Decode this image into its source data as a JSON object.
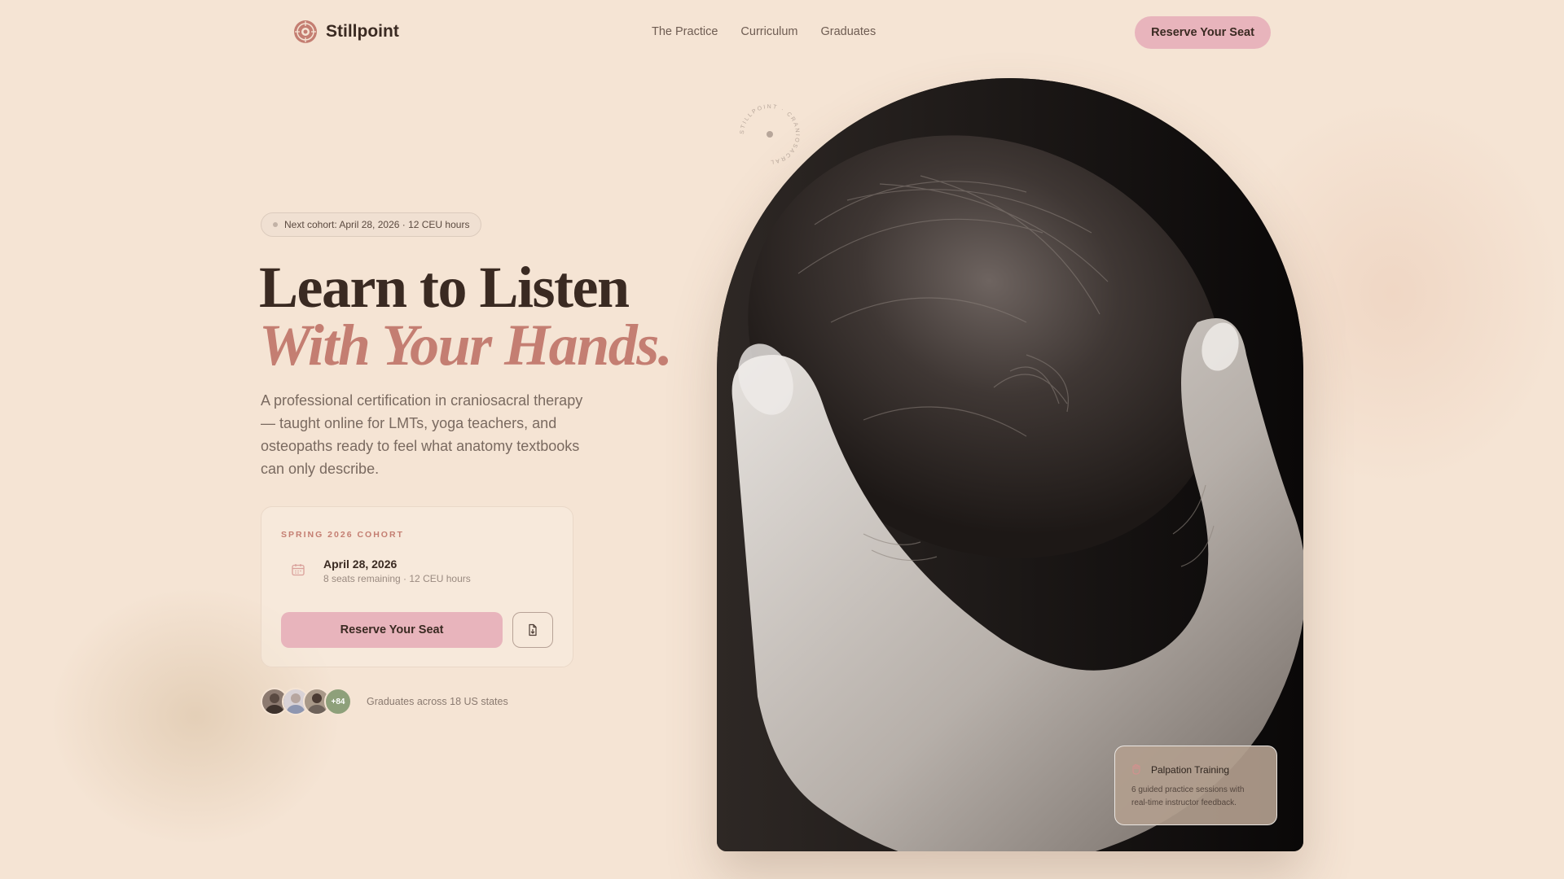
{
  "brand": {
    "name": "Stillpoint"
  },
  "nav": {
    "links": [
      "The Practice",
      "Curriculum",
      "Graduates"
    ],
    "cta_label": "Reserve Your Seat"
  },
  "hero": {
    "badge": "Next cohort: April 28, 2026 · 12 CEU hours",
    "headline_line1": "Learn to Listen",
    "headline_line2": "With Your Hands.",
    "lead": "A professional certification in craniosacral therapy — taught online for LMTs, yoga teachers, and osteopaths ready to feel what anatomy textbooks can only describe."
  },
  "cohort_card": {
    "eyebrow": "SPRING 2026 COHORT",
    "date": "April 28, 2026",
    "meta": "8 seats remaining · 12 CEU hours",
    "cta_label": "Reserve Your Seat",
    "icon": "calendar-icon",
    "secondary_icon": "document-download-icon"
  },
  "graduates": {
    "count_label": "+84",
    "text": "Graduates across 18 US states"
  },
  "feature_card": {
    "title": "Palpation Training",
    "description": "6 guided practice sessions with real-time instructor feedback.",
    "icon": "hand-icon"
  },
  "seal": {
    "text": "STILLPOINT · CRANIOSACRAL"
  },
  "colors": {
    "background": "#f5e4d4",
    "accent_pink": "#e8b4bc",
    "accent_rose": "#c47e72",
    "text_dark": "#3a2a22",
    "badge_green": "#8ea07a"
  }
}
